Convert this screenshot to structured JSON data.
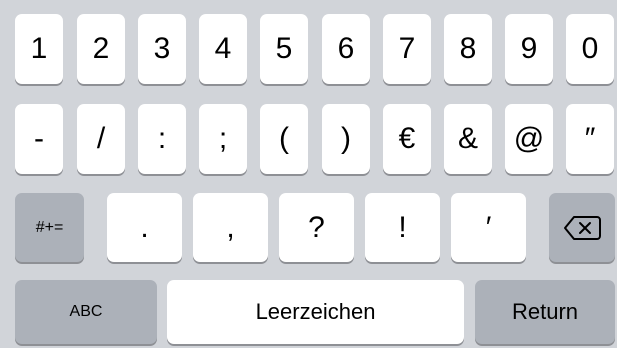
{
  "keyboard": {
    "row1": [
      "1",
      "2",
      "3",
      "4",
      "5",
      "6",
      "7",
      "8",
      "9",
      "0"
    ],
    "row2": [
      "-",
      "/",
      ":",
      ";",
      "(",
      ")",
      "€",
      "&",
      "@",
      "″"
    ],
    "row3": {
      "symbols_toggle": "#+=",
      "keys": [
        ".",
        ",",
        "?",
        "!",
        "′"
      ],
      "delete_icon": "backspace-icon"
    },
    "row4": {
      "abc": "ABC",
      "space": "Leerzeichen",
      "return": "Return"
    }
  },
  "colors": {
    "background": "#d1d4d9",
    "key": "#ffffff",
    "function_key": "#acb1b9",
    "key_shadow": "#8e9095"
  }
}
